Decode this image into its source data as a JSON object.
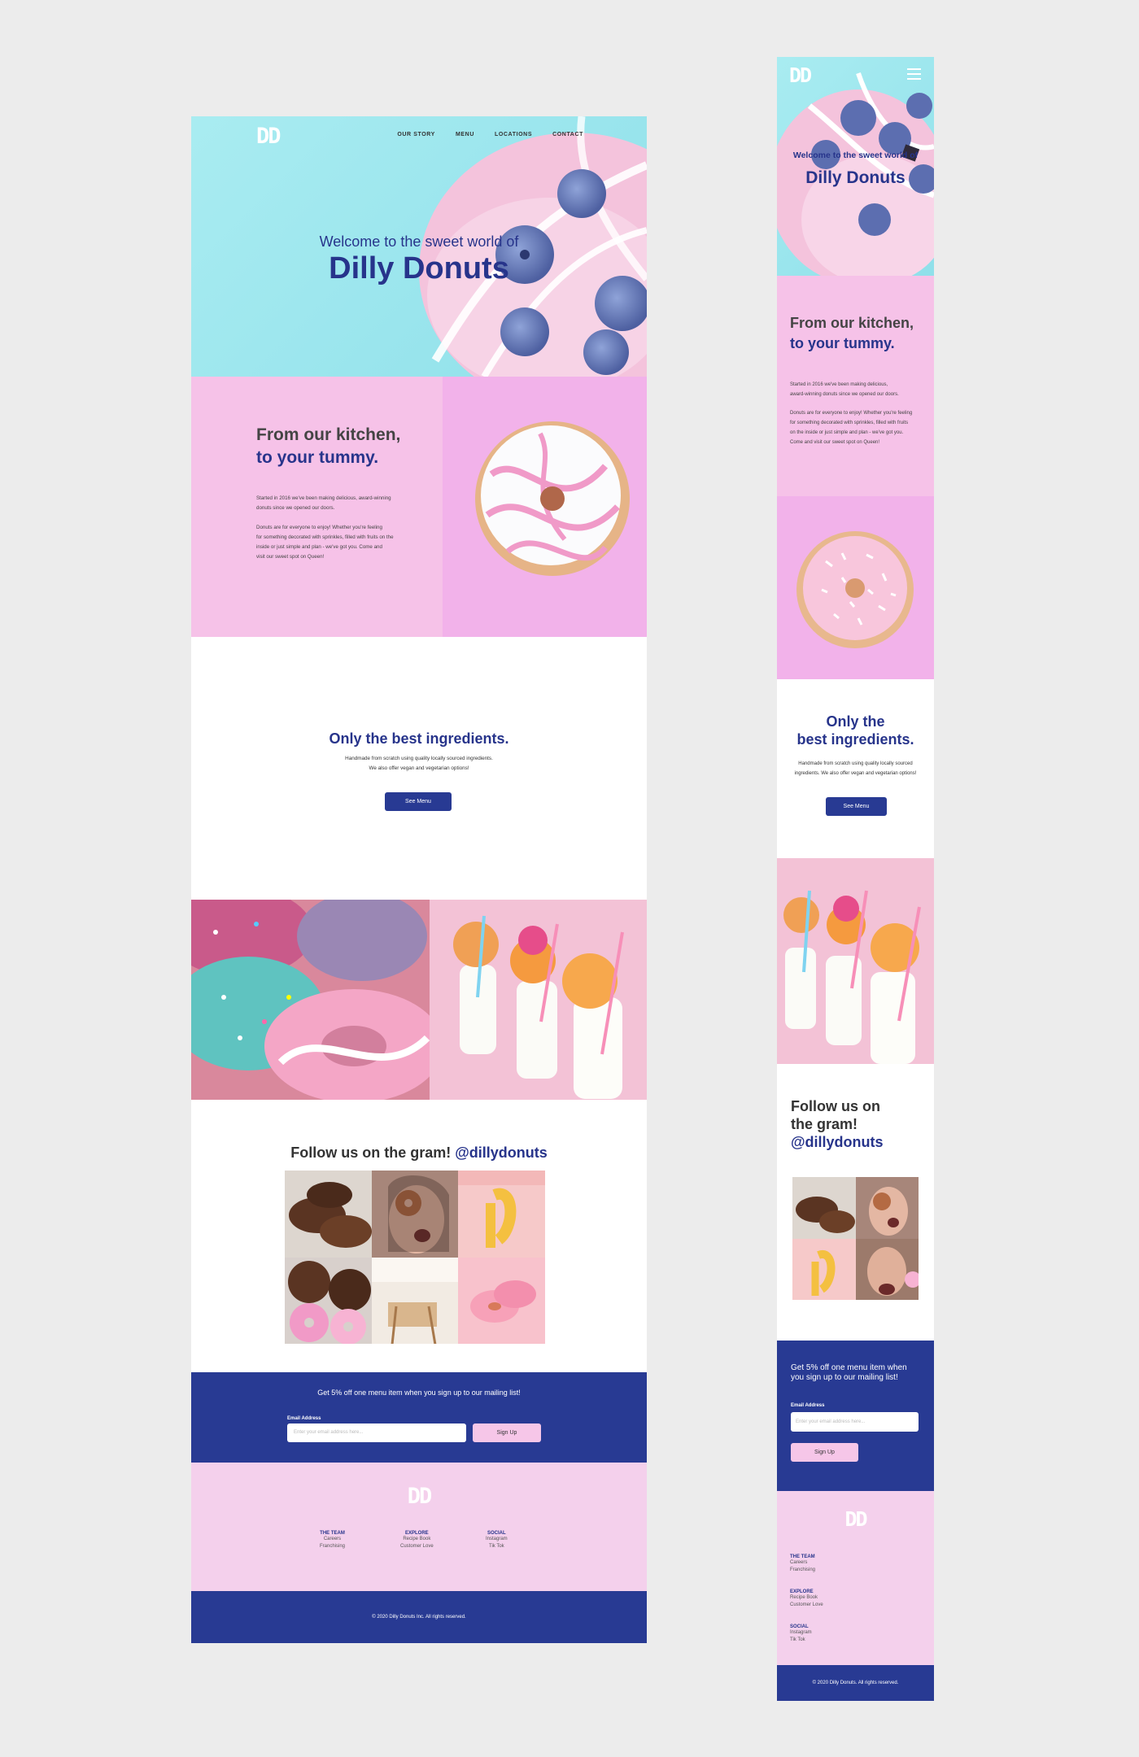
{
  "brand": {
    "logo": "DD"
  },
  "colors": {
    "primary": "#283a93",
    "pink": "#f6c2e8",
    "aqua": "#a9ecf1",
    "light_pink": "#f4d0ec"
  },
  "nav": {
    "items": [
      "OUR STORY",
      "MENU",
      "LOCATIONS",
      "CONTACT"
    ]
  },
  "hero": {
    "subtitle": "Welcome to the sweet world of",
    "title": "Dilly Donuts"
  },
  "story": {
    "heading1": "From our kitchen,",
    "heading2": "to your tummy.",
    "desktop_p1": [
      "Started in 2016 we've been making delicious, award-winning",
      "donuts since we opened our doors."
    ],
    "desktop_p2": [
      "Donuts are for everyone to enjoy! Whether you're feeling",
      "for something decorated with sprinkles, filled with fruits on the",
      "inside or just simple and plan - we've got you.  Come and",
      "visit our sweet spot on Queen!"
    ],
    "mobile_p1": [
      "Started in 2016 we've been making delicious,",
      "award-winning donuts since we opened our doors."
    ],
    "mobile_p2": [
      "Donuts are for everyone to enjoy! Whether you're feeling",
      "for something decorated with sprinkles, filled with fruits",
      "on the inside or just simple and plan - we've got you.",
      "Come and visit our sweet spot on Queen!"
    ]
  },
  "ingredients": {
    "title": "Only the best ingredients.",
    "mobile_title": [
      "Only the",
      "best ingredients."
    ],
    "desktop_lines": [
      "Handmade from scratch using quality locally sourced ingredients.",
      "We also offer vegan and vegetarian options!"
    ],
    "mobile_lines": [
      "Handmade from scratch using quality locally sourced",
      "ingredients. We also offer vegan and vegetarian options!"
    ],
    "button": "See Menu"
  },
  "gram": {
    "text": "Follow us on the gram! ",
    "handle": "@dillydonuts",
    "mobile_lines": [
      "Follow us on",
      "the gram!",
      "@dillydonuts"
    ]
  },
  "mailing": {
    "text": "Get 5% off one menu item when you sign up to our mailing list!",
    "mobile_lines": [
      "Get 5% off one menu item when",
      "you sign up to our mailing list!"
    ],
    "label": "Email Address",
    "placeholder": "Enter your email address here...",
    "mobile_placeholder": "Enter your email address here...",
    "button": "Sign Up"
  },
  "footer": {
    "columns": [
      {
        "heading": "THE TEAM",
        "items": [
          "Careers",
          "Franchising"
        ]
      },
      {
        "heading": "EXPLORE",
        "items": [
          "Recipe Book",
          "Customer Love"
        ]
      },
      {
        "heading": "SOCIAL",
        "items": [
          "Instagram",
          "Tik Tok"
        ]
      }
    ],
    "copyright": "© 2020 Dilly Donuts Inc. All rights reserved.",
    "mobile_copyright": "© 2020 Dilly Donuts. All rights reserved."
  }
}
